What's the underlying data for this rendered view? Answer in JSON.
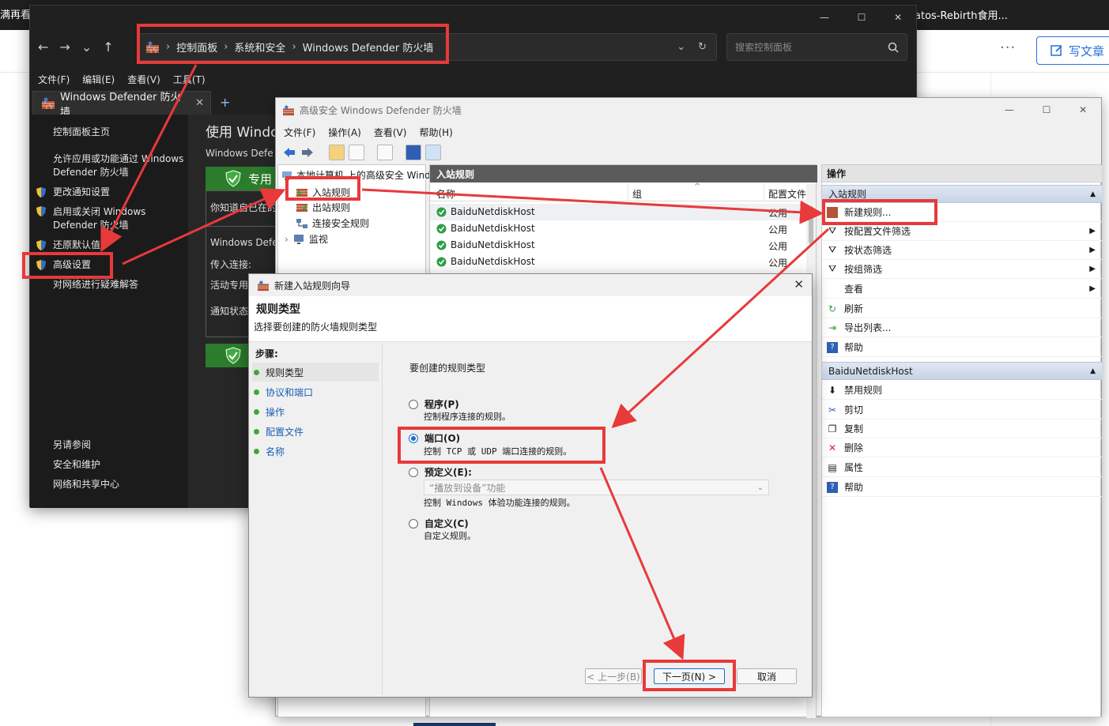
{
  "background_browser": {
    "left_title": "满再看",
    "right_title": "atos-Rebirth食用...",
    "more_label": "···",
    "write_label": "写文章"
  },
  "control_panel": {
    "nav": {
      "back": "←",
      "forward": "→",
      "down": "⌄",
      "up": "↑"
    },
    "breadcrumb": [
      "控制面板",
      "系统和安全",
      "Windows Defender 防火墙"
    ],
    "search_placeholder": "搜索控制面板",
    "menu": [
      "文件(F)",
      "编辑(E)",
      "查看(V)",
      "工具(T)"
    ],
    "tab_title": "Windows Defender 防火墙",
    "sidebar": {
      "home": "控制面板主页",
      "allow_app": "允许应用或功能通过 Windows Defender 防火墙",
      "change_notify": "更改通知设置",
      "toggle": "启用或关闭 Windows Defender 防火墙",
      "restore": "还原默认值",
      "advanced": "高级设置",
      "troubleshoot": "对网络进行疑难解答",
      "see_also": "另请参阅",
      "security": "安全和维护",
      "network": "网络和共享中心"
    },
    "main": {
      "title": "使用 Windo",
      "subtitle": "Windows Defe",
      "private_label": "专用",
      "know_text": "你知道自己在的",
      "defender_text": "Windows Defe",
      "incoming": "传入连接:",
      "active": "活动专用",
      "notify": "通知状态"
    }
  },
  "advanced_window": {
    "title": "高级安全 Windows Defender 防火墙",
    "menu": [
      "文件(F)",
      "操作(A)",
      "查看(V)",
      "帮助(H)"
    ],
    "tree": {
      "root": "本地计算机 上的高级安全 Wind",
      "inbound": "入站规则",
      "outbound": "出站规则",
      "connection": "连接安全规则",
      "monitor": "监视"
    },
    "list": {
      "header": "入站规则",
      "columns": [
        "名称",
        "组",
        "配置文件"
      ],
      "rows": [
        {
          "name": "BaiduNetdiskHost",
          "profile": "公用"
        },
        {
          "name": "BaiduNetdiskHost",
          "profile": "公用"
        },
        {
          "name": "BaiduNetdiskHost",
          "profile": "公用"
        },
        {
          "name": "BaiduNetdiskHost",
          "profile": "公用"
        }
      ]
    },
    "actions": {
      "header": "操作",
      "section1": "入站规则",
      "items1": [
        "新建规则...",
        "按配置文件筛选",
        "按状态筛选",
        "按组筛选",
        "查看",
        "刷新",
        "导出列表...",
        "帮助"
      ],
      "section2": "BaiduNetdiskHost",
      "items2": [
        "禁用规则",
        "剪切",
        "复制",
        "删除",
        "属性",
        "帮助"
      ]
    }
  },
  "wizard": {
    "title": "新建入站规则向导",
    "heading": "规则类型",
    "subheading": "选择要创建的防火墙规则类型",
    "steps_title": "步骤:",
    "steps": [
      "规则类型",
      "协议和端口",
      "操作",
      "配置文件",
      "名称"
    ],
    "prompt": "要创建的规则类型",
    "options": [
      {
        "label": "程序(P)",
        "desc": "控制程序连接的规则。"
      },
      {
        "label": "端口(O)",
        "desc": "控制 TCP 或 UDP 端口连接的规则。"
      },
      {
        "label": "预定义(E):",
        "desc": "控制 Windows 体验功能连接的规则。"
      },
      {
        "label": "自定义(C)",
        "desc": "自定义规则。"
      }
    ],
    "selected_option": "端口(O)",
    "predefined_value": "“播放到设备”功能",
    "buttons": {
      "back": "< 上一步(B)",
      "next": "下一页(N) >",
      "cancel": "取消"
    }
  },
  "colors": {
    "annotation_red": "#e8393b",
    "dark_bg": "#202020",
    "accent_blue": "#1a6fd1"
  }
}
